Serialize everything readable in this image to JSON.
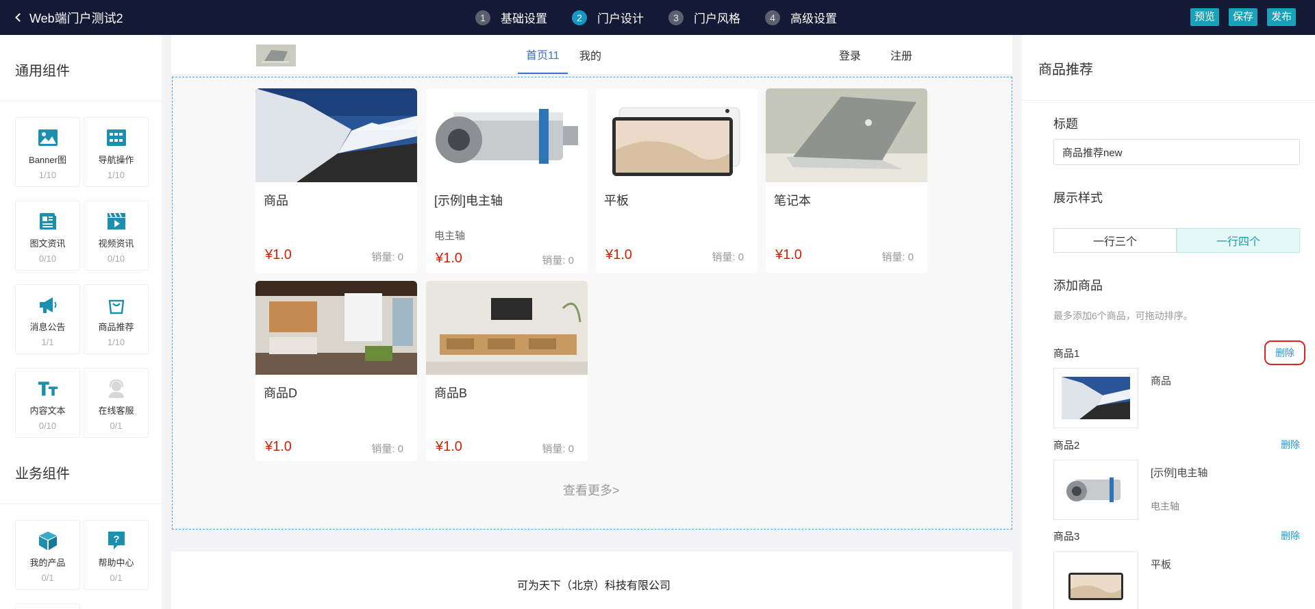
{
  "topbar": {
    "title": "Web端门户测试2",
    "steps": [
      {
        "num": "1",
        "label": "基础设置"
      },
      {
        "num": "2",
        "label": "门户设计"
      },
      {
        "num": "3",
        "label": "门户风格"
      },
      {
        "num": "4",
        "label": "高级设置"
      }
    ],
    "active_step": 2,
    "actions": {
      "preview": "预览",
      "save": "保存",
      "publish": "发布"
    },
    "colors": {
      "bar": "#141a36",
      "accent": "#1aa0b8"
    }
  },
  "left_panel": {
    "general_title": "通用组件",
    "business_title": "业务组件",
    "general": [
      {
        "name": "Banner图",
        "count": "1/10",
        "icon": "image-icon"
      },
      {
        "name": "导航操作",
        "count": "1/10",
        "icon": "navigation-icon"
      },
      {
        "name": "图文资讯",
        "count": "0/10",
        "icon": "article-icon"
      },
      {
        "name": "视频资讯",
        "count": "0/10",
        "icon": "video-icon"
      },
      {
        "name": "消息公告",
        "count": "1/1",
        "icon": "megaphone-icon"
      },
      {
        "name": "商品推荐",
        "count": "1/10",
        "icon": "shopping-bag-icon"
      },
      {
        "name": "内容文本",
        "count": "0/10",
        "icon": "text-icon"
      },
      {
        "name": "在线客服",
        "count": "0/1",
        "icon": "customer-service-icon"
      }
    ],
    "business": [
      {
        "name": "我的产品",
        "count": "0/1",
        "icon": "cube-icon"
      },
      {
        "name": "帮助中心",
        "count": "0/1",
        "icon": "help-icon"
      }
    ]
  },
  "preview": {
    "nav": {
      "home": "首页11",
      "mine": "我的",
      "login": "登录",
      "register": "注册"
    },
    "products": [
      {
        "name": "商品",
        "desc": "",
        "price": "¥1.0",
        "sales": "销量:  0",
        "image": "snow-road"
      },
      {
        "name": "[示例]电主轴",
        "desc": "电主轴",
        "price": "¥1.0",
        "sales": "销量:  0",
        "image": "spindle"
      },
      {
        "name": "平板",
        "desc": "",
        "price": "¥1.0",
        "sales": "销量:  0",
        "image": "tablet"
      },
      {
        "name": "笔记本",
        "desc": "",
        "price": "¥1.0",
        "sales": "销量:  0",
        "image": "laptop"
      },
      {
        "name": "商品D",
        "desc": "",
        "price": "¥1.0",
        "sales": "销量:  0",
        "image": "office"
      },
      {
        "name": "商品B",
        "desc": "",
        "price": "¥1.0",
        "sales": "销量:  0",
        "image": "living-room"
      }
    ],
    "more": "查看更多>",
    "footer": "可为天下（北京）科技有限公司",
    "price_color": "#d81e06"
  },
  "right_panel": {
    "title": "商品推荐",
    "title_label": "标题",
    "title_value": "商品推荐new",
    "style_label": "展示样式",
    "style_options": [
      "一行三个",
      "一行四个"
    ],
    "style_selected": "一行四个",
    "add_label": "添加商品",
    "hint": "最多添加6个商品，可拖动排序。",
    "delete_label": "删除",
    "items": [
      {
        "label": "商品1",
        "name": "商品",
        "desc": ""
      },
      {
        "label": "商品2",
        "name": "[示例]电主轴",
        "desc": "电主轴"
      },
      {
        "label": "商品3",
        "name": "平板",
        "desc": ""
      }
    ]
  }
}
